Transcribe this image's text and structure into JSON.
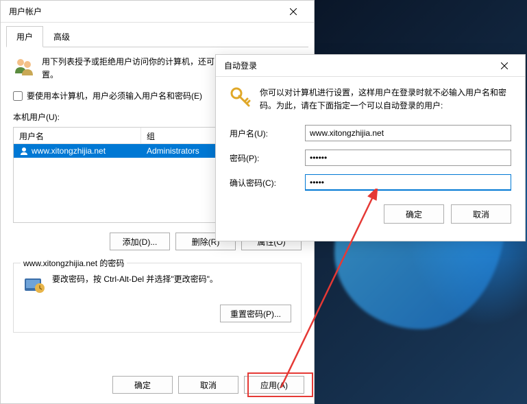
{
  "main_window": {
    "title": "用户帐户",
    "tabs": {
      "users": "用户",
      "advanced": "高级"
    },
    "description": "用下列表授予或拒绝用户访问你的计算机，还可以更改其密码和其他设置。",
    "require_login_checkbox": "要使用本计算机，用户必须输入用户名和密码(E)",
    "local_users_label": "本机用户(U):",
    "table": {
      "header_name": "用户名",
      "header_group": "组",
      "rows": [
        {
          "name": "www.xitongzhijia.net",
          "group": "Administrators"
        }
      ]
    },
    "buttons": {
      "add": "添加(D)...",
      "remove": "删除(R)",
      "properties": "属性(O)"
    },
    "password_section": {
      "legend": "www.xitongzhijia.net 的密码",
      "text": "要改密码，按 Ctrl-Alt-Del 并选择\"更改密码\"。",
      "reset_button": "重置密码(P)..."
    },
    "bottom_buttons": {
      "ok": "确定",
      "cancel": "取消",
      "apply": "应用(A)"
    }
  },
  "dialog": {
    "title": "自动登录",
    "description": "你可以对计算机进行设置，这样用户在登录时就不必输入用户名和密码。为此，请在下面指定一个可以自动登录的用户:",
    "labels": {
      "username": "用户名(U):",
      "password": "密码(P):",
      "confirm": "确认密码(C):"
    },
    "values": {
      "username": "www.xitongzhijia.net",
      "password": "••••••",
      "confirm": "•••••"
    },
    "buttons": {
      "ok": "确定",
      "cancel": "取消"
    }
  }
}
